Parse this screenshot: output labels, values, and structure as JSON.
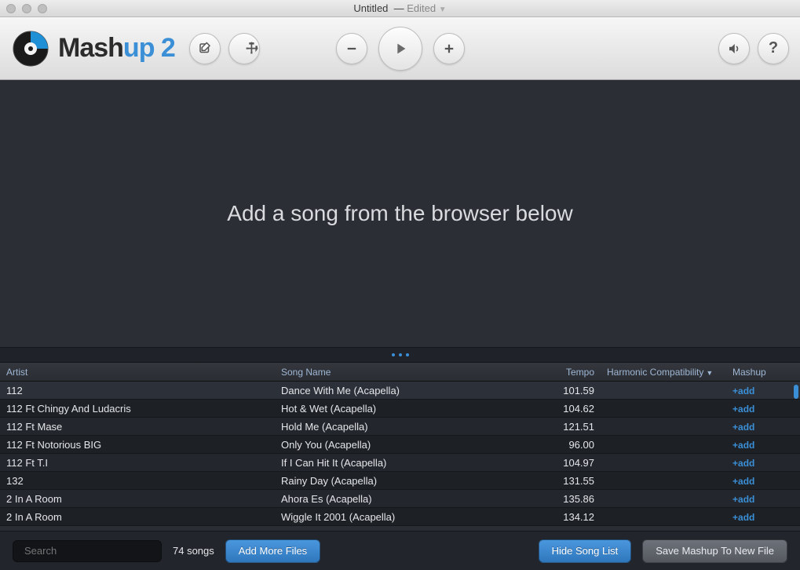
{
  "window": {
    "title": "Untitled",
    "status": "Edited"
  },
  "brand": {
    "name_a": "Mash",
    "name_b": "up",
    "version": "2"
  },
  "droparea": {
    "message": "Add a song from the browser below"
  },
  "columns": {
    "artist": "Artist",
    "song": "Song Name",
    "tempo": "Tempo",
    "harmonic": "Harmonic Compatibility",
    "mashup": "Mashup"
  },
  "add_label": "add",
  "songs": [
    {
      "artist": "112",
      "name": "Dance With Me (Acapella)",
      "tempo": "101.59"
    },
    {
      "artist": "112 Ft Chingy And Ludacris",
      "name": "Hot & Wet (Acapella)",
      "tempo": "104.62"
    },
    {
      "artist": "112 Ft Mase",
      "name": "Hold Me (Acapella)",
      "tempo": "121.51"
    },
    {
      "artist": "112 Ft Notorious BIG",
      "name": "Only You (Acapella)",
      "tempo": "96.00"
    },
    {
      "artist": "112 Ft T.I",
      "name": "If I Can Hit It (Acapella)",
      "tempo": "104.97"
    },
    {
      "artist": "132",
      "name": "Rainy Day (Acapella)",
      "tempo": "131.55"
    },
    {
      "artist": "2 In A Room",
      "name": "Ahora Es (Acapella)",
      "tempo": "135.86"
    },
    {
      "artist": "2 In A Room",
      "name": "Wiggle It 2001 (Acapella)",
      "tempo": "134.12"
    }
  ],
  "search": {
    "placeholder": "Search"
  },
  "count_label": "74 songs",
  "buttons": {
    "add_more": "Add More Files",
    "hide_list": "Hide Song List",
    "save_mashup": "Save Mashup To New File"
  }
}
